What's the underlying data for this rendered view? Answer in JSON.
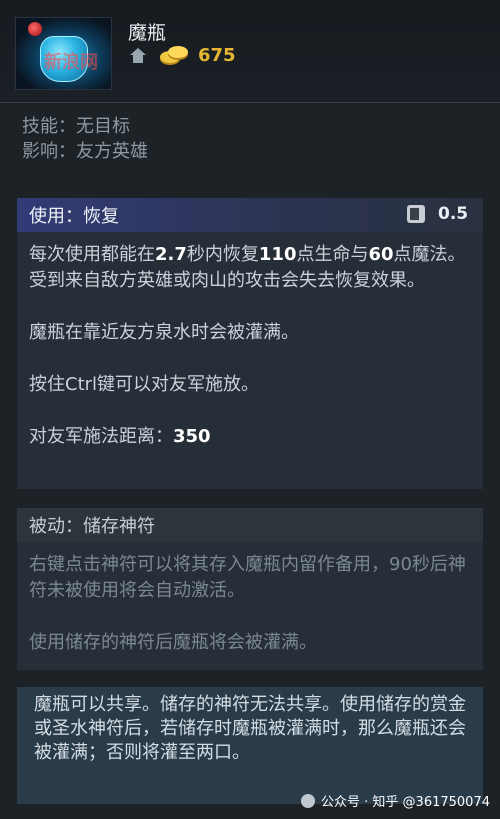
{
  "item": {
    "name": "魔瓶",
    "cost": "675",
    "logo_watermark": "新浪网"
  },
  "meta": {
    "ability_label": "技能：",
    "ability_value": "无目标",
    "affects_label": "影响：",
    "affects_value": "友方英雄"
  },
  "active": {
    "title": "使用：恢复",
    "cooldown": "0.5",
    "desc_p1_a": "每次使用都能在",
    "desc_p1_b": "2.7",
    "desc_p1_c": "秒内恢复",
    "desc_p1_d": "110",
    "desc_p1_e": "点生命与",
    "desc_p1_f": "60",
    "desc_p1_g": "点魔法。受到来自敌方英雄或肉山的攻击会失去恢复效果。",
    "desc_p2": "魔瓶在靠近友方泉水时会被灌满。",
    "desc_p3": "按住Ctrl键可以对友军施放。",
    "range_label": "对友军施法距离：",
    "range_value": "350"
  },
  "passive": {
    "title": "被动：储存神符",
    "desc_p1": "右键点击神符可以将其存入魔瓶内留作备用，90秒后神符未被使用将会自动激活。",
    "desc_p2": "使用储存的神符后魔瓶将会被灌满。"
  },
  "note": {
    "text": "魔瓶可以共享。储存的神符无法共享。使用储存的赏金或圣水神符后，若储存时魔瓶被灌满时，那么魔瓶还会被灌满；否则将灌至两口。"
  },
  "watermark": {
    "text": "公众号 · 知乎 @361750074"
  },
  "colors": {
    "gold": "#e6b733",
    "active_header": "#333b77",
    "note_bg": "#2a3c4a"
  }
}
